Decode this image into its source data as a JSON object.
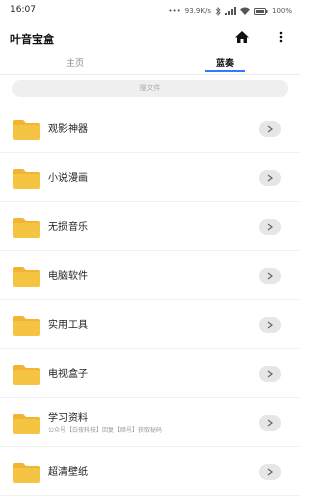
{
  "status": {
    "time": "16:07",
    "network_speed": "93.9K/s",
    "battery": "100%"
  },
  "app": {
    "title": "叶音宝盒",
    "home_icon": "home-icon",
    "more_icon": "more-vertical-icon"
  },
  "tabs": [
    {
      "label": "主页",
      "active": false
    },
    {
      "label": "蓝奏",
      "active": true
    }
  ],
  "search": {
    "placeholder": "搜文件"
  },
  "folders": [
    {
      "title": "观影神器",
      "subtitle": ""
    },
    {
      "title": "小说漫画",
      "subtitle": ""
    },
    {
      "title": "无损音乐",
      "subtitle": ""
    },
    {
      "title": "电脑软件",
      "subtitle": ""
    },
    {
      "title": "实用工具",
      "subtitle": ""
    },
    {
      "title": "电视盒子",
      "subtitle": ""
    },
    {
      "title": "学习资料",
      "subtitle": "公众号【白夜科技】回复【暗号】获取秘码"
    },
    {
      "title": "超清壁纸",
      "subtitle": ""
    }
  ],
  "colors": {
    "accent": "#2b7cff",
    "folder": "#f6c443",
    "folder_tab": "#f2b431"
  }
}
